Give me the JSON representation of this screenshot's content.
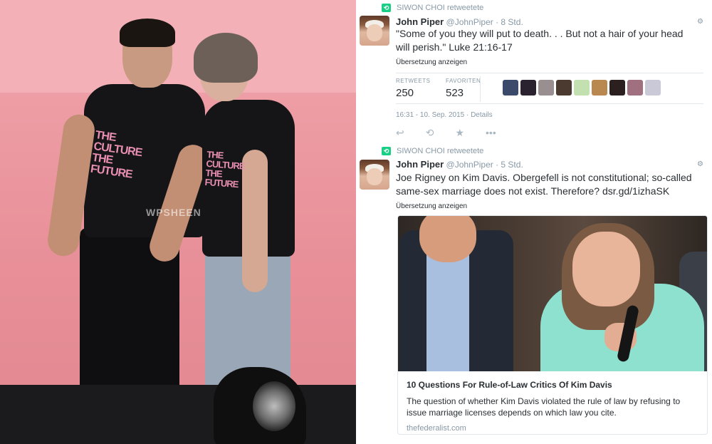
{
  "photo": {
    "shirt_text_left": "THE CULTURE THE FUTURE",
    "shirt_text_right": "THE CULTURE THE FUTURE",
    "watermark": "WPSHEEN"
  },
  "tweets": [
    {
      "retweet_label": "SIWON CHOI retweetete",
      "name": "John Piper",
      "handle": "@JohnPiper",
      "time": "· 8 Std.",
      "text": "\"Some of you they will put to death. . . But not a hair of your head will perish.\" Luke 21:16-17",
      "translate_label": "Übersetzung anzeigen",
      "retweets_label": "RETWEETS",
      "retweets_value": "250",
      "favorites_label": "FAVORITEN",
      "favorites_value": "523",
      "timestamp": "16:31 - 10. Sep. 2015 · Details",
      "action_icons": [
        "reply-icon",
        "retweet-icon",
        "favorite-icon",
        "more-icon"
      ]
    },
    {
      "retweet_label": "SIWON CHOI retweetete",
      "name": "John Piper",
      "handle": "@JohnPiper",
      "time": "· 5 Std.",
      "text": "Joe Rigney on Kim Davis. Obergefell is not constitutional; so-called same-sex marriage does not exist. Therefore?",
      "link": "dsr.gd/1izhaSK",
      "translate_label": "Übersetzung anzeigen",
      "card": {
        "title": "10 Questions For Rule-of-Law Critics Of Kim Davis",
        "description": "The question of whether Kim Davis violated the rule of law by refusing to issue marriage licenses depends on which law you cite.",
        "domain": "thefederalist.com"
      }
    }
  ],
  "facepile_colors": [
    "#3b4a6b",
    "#2b2230",
    "#9a8f90",
    "#4a3a30",
    "#c2e0b0",
    "#b88850",
    "#2b1f1f",
    "#a07080",
    "#c9c9d8"
  ],
  "colors": {
    "retweet_green": "#19cf86",
    "muted_text": "#8899a6",
    "border": "#e1e8ed"
  }
}
